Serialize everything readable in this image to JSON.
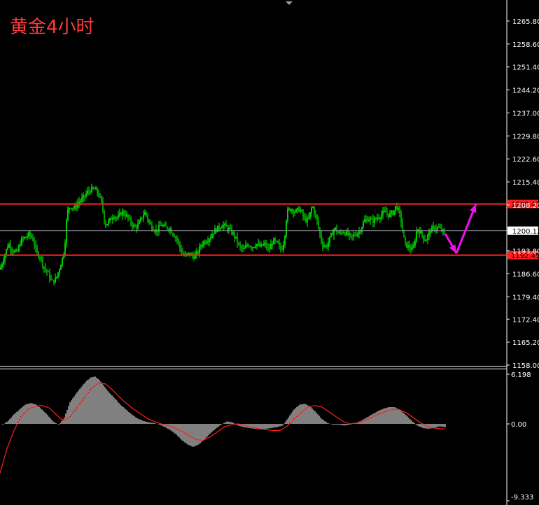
{
  "title": "黄金4小时",
  "chart_data": [
    {
      "type": "candlestick",
      "title": "黄金4小时",
      "ylim": [
        1158.0,
        1269.0
      ],
      "y_ticks": [
        "1265.80",
        "1258.60",
        "1251.40",
        "1244.20",
        "1237.00",
        "1229.80",
        "1222.60",
        "1215.40",
        "1208.20",
        "1200.12",
        "1193.80",
        "1186.60",
        "1179.40",
        "1172.40",
        "1165.20",
        "1158.00"
      ],
      "y_tick_values": [
        1265.8,
        1258.6,
        1251.4,
        1244.2,
        1237.0,
        1229.8,
        1222.6,
        1215.4,
        1208.2,
        1200.12,
        1193.8,
        1186.6,
        1179.4,
        1172.4,
        1165.2,
        1158.0
      ],
      "current_price": "1200.12",
      "resistance": {
        "label": "1208.47",
        "value": 1208.47,
        "color": "#ff2020"
      },
      "support": {
        "label": "1192.45",
        "value": 1192.45,
        "color": "#ff2020"
      },
      "candle_color": "#00ff00",
      "path_anchors": [
        [
          0,
          1188
        ],
        [
          6,
          1192
        ],
        [
          12,
          1196
        ],
        [
          18,
          1194
        ],
        [
          24,
          1193
        ],
        [
          30,
          1197
        ],
        [
          36,
          1198
        ],
        [
          42,
          1199
        ],
        [
          48,
          1197
        ],
        [
          52,
          1193
        ],
        [
          58,
          1192
        ],
        [
          62,
          1189
        ],
        [
          68,
          1187
        ],
        [
          74,
          1184
        ],
        [
          80,
          1185
        ],
        [
          86,
          1189
        ],
        [
          92,
          1194
        ],
        [
          96,
          1206
        ],
        [
          100,
          1208
        ],
        [
          106,
          1207
        ],
        [
          112,
          1209
        ],
        [
          118,
          1210
        ],
        [
          124,
          1212
        ],
        [
          130,
          1213
        ],
        [
          136,
          1213
        ],
        [
          142,
          1211
        ],
        [
          146,
          1208
        ],
        [
          150,
          1202
        ],
        [
          156,
          1203
        ],
        [
          162,
          1205
        ],
        [
          168,
          1204
        ],
        [
          174,
          1206
        ],
        [
          180,
          1205
        ],
        [
          186,
          1203
        ],
        [
          192,
          1201
        ],
        [
          198,
          1202
        ],
        [
          204,
          1205
        ],
        [
          208,
          1206
        ],
        [
          212,
          1203
        ],
        [
          218,
          1201
        ],
        [
          224,
          1200
        ],
        [
          230,
          1202
        ],
        [
          236,
          1201
        ],
        [
          242,
          1201
        ],
        [
          248,
          1199
        ],
        [
          254,
          1197
        ],
        [
          258,
          1194
        ],
        [
          264,
          1192
        ],
        [
          270,
          1193
        ],
        [
          276,
          1192
        ],
        [
          282,
          1193
        ],
        [
          288,
          1196
        ],
        [
          294,
          1197
        ],
        [
          300,
          1198
        ],
        [
          306,
          1200
        ],
        [
          312,
          1201
        ],
        [
          318,
          1202
        ],
        [
          324,
          1201
        ],
        [
          330,
          1200
        ],
        [
          336,
          1198
        ],
        [
          342,
          1195
        ],
        [
          348,
          1194
        ],
        [
          354,
          1196
        ],
        [
          360,
          1195
        ],
        [
          366,
          1196
        ],
        [
          372,
          1195
        ],
        [
          378,
          1196
        ],
        [
          384,
          1194
        ],
        [
          390,
          1197
        ],
        [
          396,
          1196
        ],
        [
          402,
          1194
        ],
        [
          406,
          1197
        ],
        [
          410,
          1206
        ],
        [
          416,
          1207
        ],
        [
          422,
          1206
        ],
        [
          428,
          1207
        ],
        [
          434,
          1204
        ],
        [
          440,
          1203
        ],
        [
          446,
          1208
        ],
        [
          452,
          1204
        ],
        [
          456,
          1200
        ],
        [
          460,
          1196
        ],
        [
          466,
          1195
        ],
        [
          472,
          1198
        ],
        [
          478,
          1201
        ],
        [
          484,
          1199
        ],
        [
          490,
          1200
        ],
        [
          496,
          1199
        ],
        [
          502,
          1198
        ],
        [
          508,
          1199
        ],
        [
          514,
          1200
        ],
        [
          520,
          1203
        ],
        [
          526,
          1204
        ],
        [
          532,
          1203
        ],
        [
          538,
          1204
        ],
        [
          544,
          1205
        ],
        [
          550,
          1206
        ],
        [
          556,
          1205
        ],
        [
          562,
          1206
        ],
        [
          566,
          1208
        ],
        [
          570,
          1206
        ],
        [
          574,
          1202
        ],
        [
          578,
          1196
        ],
        [
          584,
          1195
        ],
        [
          590,
          1194
        ],
        [
          596,
          1201
        ],
        [
          602,
          1199
        ],
        [
          608,
          1197
        ],
        [
          614,
          1200
        ],
        [
          620,
          1201
        ],
        [
          626,
          1201
        ],
        [
          632,
          1200
        ],
        [
          636,
          1199
        ]
      ],
      "projection": {
        "color": "#ee11ee",
        "points": [
          [
            1199.2,
            636
          ],
          [
            1193.0,
            652
          ],
          [
            1208.5,
            680
          ]
        ]
      }
    },
    {
      "type": "macd",
      "ylim": [
        -9.333,
        6.198
      ],
      "y_ticks": [
        "6.198",
        "0.00",
        "-9.333"
      ],
      "y_tick_values": [
        6.198,
        0.0,
        -9.333
      ],
      "signal_color": "#ff2020",
      "histogram_color": "#ffffff",
      "histogram_anchors": [
        [
          4,
          -0.1
        ],
        [
          12,
          0.4
        ],
        [
          20,
          1.2
        ],
        [
          28,
          1.8
        ],
        [
          36,
          2.4
        ],
        [
          44,
          2.6
        ],
        [
          52,
          2.4
        ],
        [
          60,
          1.8
        ],
        [
          68,
          1.1
        ],
        [
          76,
          0.3
        ],
        [
          84,
          -0.1
        ],
        [
          92,
          0.8
        ],
        [
          100,
          2.7
        ],
        [
          108,
          3.7
        ],
        [
          116,
          4.6
        ],
        [
          124,
          5.4
        ],
        [
          130,
          5.8
        ],
        [
          136,
          5.9
        ],
        [
          142,
          5.5
        ],
        [
          148,
          4.8
        ],
        [
          156,
          3.9
        ],
        [
          164,
          3.2
        ],
        [
          172,
          2.4
        ],
        [
          180,
          1.8
        ],
        [
          188,
          1.2
        ],
        [
          196,
          0.7
        ],
        [
          204,
          0.4
        ],
        [
          212,
          0.2
        ],
        [
          220,
          0.1
        ],
        [
          228,
          -0.1
        ],
        [
          236,
          -0.4
        ],
        [
          244,
          -0.8
        ],
        [
          252,
          -1.3
        ],
        [
          260,
          -2.0
        ],
        [
          268,
          -2.5
        ],
        [
          276,
          -2.8
        ],
        [
          284,
          -2.5
        ],
        [
          292,
          -1.9
        ],
        [
          300,
          -1.2
        ],
        [
          308,
          -0.6
        ],
        [
          316,
          -0.1
        ],
        [
          324,
          0.3
        ],
        [
          332,
          0.2
        ],
        [
          340,
          -0.2
        ],
        [
          348,
          -0.4
        ],
        [
          356,
          -0.5
        ],
        [
          364,
          -0.6
        ],
        [
          372,
          -0.6
        ],
        [
          380,
          -0.6
        ],
        [
          388,
          -0.5
        ],
        [
          396,
          -0.4
        ],
        [
          404,
          -0.2
        ],
        [
          412,
          0.8
        ],
        [
          420,
          1.8
        ],
        [
          428,
          2.4
        ],
        [
          436,
          2.5
        ],
        [
          444,
          2.1
        ],
        [
          452,
          1.4
        ],
        [
          460,
          0.6
        ],
        [
          468,
          0.1
        ],
        [
          476,
          -0.1
        ],
        [
          484,
          -0.1
        ],
        [
          492,
          -0.2
        ],
        [
          500,
          -0.1
        ],
        [
          508,
          0.1
        ],
        [
          516,
          0.4
        ],
        [
          524,
          0.8
        ],
        [
          532,
          1.2
        ],
        [
          540,
          1.6
        ],
        [
          548,
          1.9
        ],
        [
          556,
          2.1
        ],
        [
          564,
          2.1
        ],
        [
          572,
          1.7
        ],
        [
          580,
          1.1
        ],
        [
          588,
          0.4
        ],
        [
          596,
          -0.2
        ],
        [
          604,
          -0.5
        ],
        [
          612,
          -0.6
        ],
        [
          620,
          -0.5
        ],
        [
          628,
          -0.3
        ],
        [
          636,
          -0.4
        ]
      ],
      "signal_anchors": [
        [
          0,
          -6.0
        ],
        [
          10,
          -3.0
        ],
        [
          20,
          -0.8
        ],
        [
          30,
          0.9
        ],
        [
          40,
          1.8
        ],
        [
          50,
          2.2
        ],
        [
          60,
          2.3
        ],
        [
          70,
          2.0
        ],
        [
          80,
          1.2
        ],
        [
          90,
          0.4
        ],
        [
          100,
          0.9
        ],
        [
          110,
          2.0
        ],
        [
          120,
          3.2
        ],
        [
          130,
          4.4
        ],
        [
          140,
          5.1
        ],
        [
          150,
          5.0
        ],
        [
          160,
          4.3
        ],
        [
          170,
          3.4
        ],
        [
          180,
          2.6
        ],
        [
          190,
          1.9
        ],
        [
          200,
          1.3
        ],
        [
          210,
          0.7
        ],
        [
          220,
          0.3
        ],
        [
          230,
          0.0
        ],
        [
          240,
          -0.2
        ],
        [
          250,
          -0.5
        ],
        [
          260,
          -0.9
        ],
        [
          270,
          -1.4
        ],
        [
          280,
          -1.9
        ],
        [
          290,
          -2.0
        ],
        [
          300,
          -1.6
        ],
        [
          310,
          -1.0
        ],
        [
          320,
          -0.4
        ],
        [
          330,
          -0.1
        ],
        [
          340,
          0.0
        ],
        [
          350,
          -0.2
        ],
        [
          360,
          -0.4
        ],
        [
          370,
          -0.6
        ],
        [
          380,
          -0.7
        ],
        [
          390,
          -0.8
        ],
        [
          400,
          -0.8
        ],
        [
          410,
          -0.3
        ],
        [
          420,
          0.6
        ],
        [
          430,
          1.4
        ],
        [
          440,
          2.1
        ],
        [
          450,
          2.3
        ],
        [
          460,
          2.1
        ],
        [
          470,
          1.5
        ],
        [
          480,
          0.9
        ],
        [
          490,
          0.3
        ],
        [
          500,
          0.0
        ],
        [
          510,
          0.1
        ],
        [
          520,
          0.4
        ],
        [
          530,
          0.8
        ],
        [
          540,
          1.2
        ],
        [
          550,
          1.5
        ],
        [
          560,
          1.8
        ],
        [
          570,
          1.8
        ],
        [
          580,
          1.4
        ],
        [
          590,
          0.8
        ],
        [
          600,
          0.2
        ],
        [
          610,
          -0.3
        ],
        [
          620,
          -0.5
        ],
        [
          630,
          -0.6
        ],
        [
          636,
          -0.6
        ]
      ]
    }
  ]
}
